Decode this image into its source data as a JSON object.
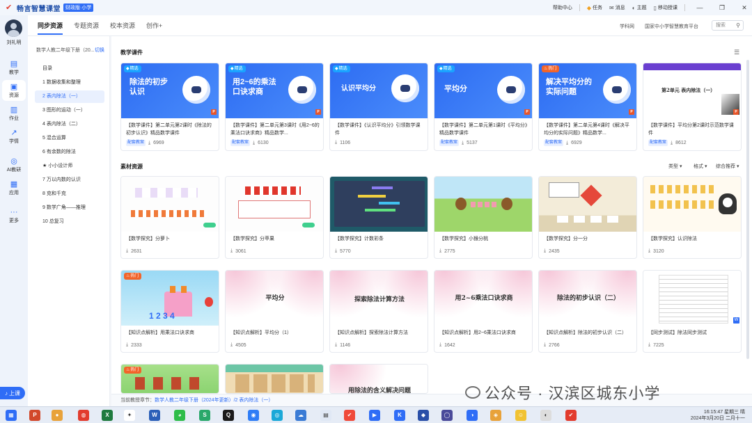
{
  "app": {
    "name": "畅言智慧课堂",
    "edition": "财政版·小学"
  },
  "titlebar": {
    "help": "帮助中心",
    "task": "任务",
    "messages": "消息",
    "theme": "主题",
    "mobile": "移动授课"
  },
  "rail": {
    "user": "刘礼明",
    "items": [
      {
        "label": "教学",
        "icon": "teach-icon"
      },
      {
        "label": "资源",
        "icon": "resource-icon"
      },
      {
        "label": "作业",
        "icon": "homework-icon"
      },
      {
        "label": "学情",
        "icon": "chart-icon"
      },
      {
        "label": "AI教研",
        "icon": "ai-icon"
      },
      {
        "label": "应用",
        "icon": "apps-icon"
      },
      {
        "label": "更多",
        "icon": "more-icon"
      }
    ],
    "upload": "上课"
  },
  "topnav": {
    "tabs": [
      "同步资源",
      "专题资源",
      "校本资源",
      "创作+"
    ],
    "links": [
      "学科网",
      "国家中小学智慧教育平台"
    ],
    "search_placeholder": "搜索"
  },
  "tree": {
    "book": "数学人教二年级下册（20...",
    "switch": "切换",
    "items": [
      "目录",
      "1 数据收集和整理",
      "2 表内除法（一）",
      "3 图形的运动（一）",
      "4 表内除法（二）",
      "5 混合运算",
      "6 有余数的除法",
      "★ 小小设计师",
      "7 万以内数的认识",
      "8 克和千克",
      "9 数学广角——推理",
      "10 总复习"
    ]
  },
  "sections": {
    "courseware": "教学课件",
    "materials": "素材资源"
  },
  "filters": [
    "类型",
    "格式",
    "综合推荐"
  ],
  "courseware": [
    {
      "badge": "精选",
      "thumb_title": "除法的初步认识",
      "title": "【数学课件】第二单元第2课时《除法的初步认识》精品数学课件",
      "tag": "配套教案",
      "downloads": "6969"
    },
    {
      "badge": "精选",
      "thumb_title": "用2~6的乘法口诀求商",
      "title": "【数学课件】第二单元第3课时《用2~6的乘法口诀求商》精品数学...",
      "tag": "配套教案",
      "downloads": "6130"
    },
    {
      "badge": "精选",
      "thumb_title": "认识平均分",
      "title": "【数学课件】《认识平均分》引领数学课件",
      "tag": "",
      "downloads": "1106"
    },
    {
      "badge": "精选",
      "thumb_title": "平均分",
      "title": "【数学课件】第二单元第1课时《平均分》精品数学课件",
      "tag": "配套教案",
      "downloads": "5137"
    },
    {
      "badge": "热门",
      "thumb_title": "解决平均分的实际问题",
      "title": "【数学课件】第二单元第4课时《解决平均分的实际问题》精品数学...",
      "tag": "配套教案",
      "downloads": "6929"
    },
    {
      "badge": "",
      "thumb_title": "第2单元 表内除法（一）",
      "title": "【数学课件】平均分第2课时示范数学课件",
      "tag": "配套教案",
      "downloads": "8612"
    }
  ],
  "materials": [
    {
      "badge": "",
      "thumb_title": "",
      "title": "【数学探究】分萝卜",
      "downloads": "2631"
    },
    {
      "badge": "",
      "thumb_title": "",
      "title": "【数学探究】分苹果",
      "downloads": "3061"
    },
    {
      "badge": "",
      "thumb_title": "",
      "title": "【数学探究】计数彩条",
      "downloads": "5770"
    },
    {
      "badge": "",
      "thumb_title": "",
      "title": "【数学探究】小猴分桃",
      "downloads": "2775"
    },
    {
      "badge": "",
      "thumb_title": "",
      "title": "【数学探究】分一分",
      "downloads": "2435"
    },
    {
      "badge": "",
      "thumb_title": "",
      "title": "【数学探究】认识除法",
      "downloads": "3120"
    },
    {
      "badge": "热门",
      "thumb_title": "",
      "title": "【知识点解析】用乘法口诀求商",
      "downloads": "2333"
    },
    {
      "badge": "",
      "thumb_title": "平均分",
      "title": "【知识点解析】平均分（1）",
      "downloads": "4505"
    },
    {
      "badge": "",
      "thumb_title": "探索除法计算方法",
      "title": "【知识点解析】探索除法计算方法",
      "downloads": "1146"
    },
    {
      "badge": "",
      "thumb_title": "用2~6乘法口诀求商",
      "title": "【知识点解析】用2~6乘法口诀求商",
      "downloads": "1642"
    },
    {
      "badge": "",
      "thumb_title": "除法的初步认识（二）",
      "title": "【知识点解析】除法的初步认识（二）",
      "downloads": "2766"
    },
    {
      "badge": "",
      "thumb_title": "",
      "title": "【同步测试】除法同步测试",
      "downloads": "7225"
    },
    {
      "badge": "热门",
      "thumb_title": "",
      "title": "",
      "downloads": ""
    },
    {
      "badge": "",
      "thumb_title": "",
      "title": "",
      "downloads": ""
    },
    {
      "badge": "",
      "thumb_title": "用除法的含义解决问题",
      "title": "",
      "downloads": ""
    }
  ],
  "status": {
    "prefix": "当前教授章节：",
    "chapter": "数学人教二年级下册（2024年更新）/2 表内除法（一）"
  },
  "watermark": "公众号 · 汉滨区城东小学",
  "clock": {
    "time": "16:15:47 星期三 晴",
    "date": "2024年3月20日 二月十一"
  },
  "colors": {
    "accent": "#2f6df6",
    "hot": "#f2642a",
    "featured": "#1aa3ff"
  }
}
